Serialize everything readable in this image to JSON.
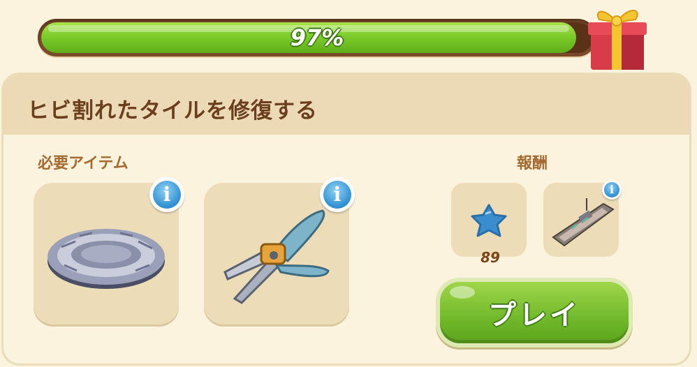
{
  "progress": {
    "value": 0.97,
    "label": "97%"
  },
  "task": {
    "title": "ヒビ割れたタイルを修復する"
  },
  "required": {
    "label": "必要アイテム",
    "items": [
      {
        "icon": "stone-tile-icon",
        "info": "i"
      },
      {
        "icon": "pruning-shears-icon",
        "info": "i"
      }
    ]
  },
  "rewards": {
    "label": "報酬",
    "items": [
      {
        "icon": "blue-star-icon",
        "count": "89"
      },
      {
        "icon": "ship-icon",
        "info": "i"
      }
    ]
  },
  "play_button": {
    "label": "プレイ"
  },
  "colors": {
    "progress_fill": "#7ccc2a",
    "title": "#6b3f1e",
    "section_label": "#a46a2f",
    "play": "#71b92a"
  }
}
